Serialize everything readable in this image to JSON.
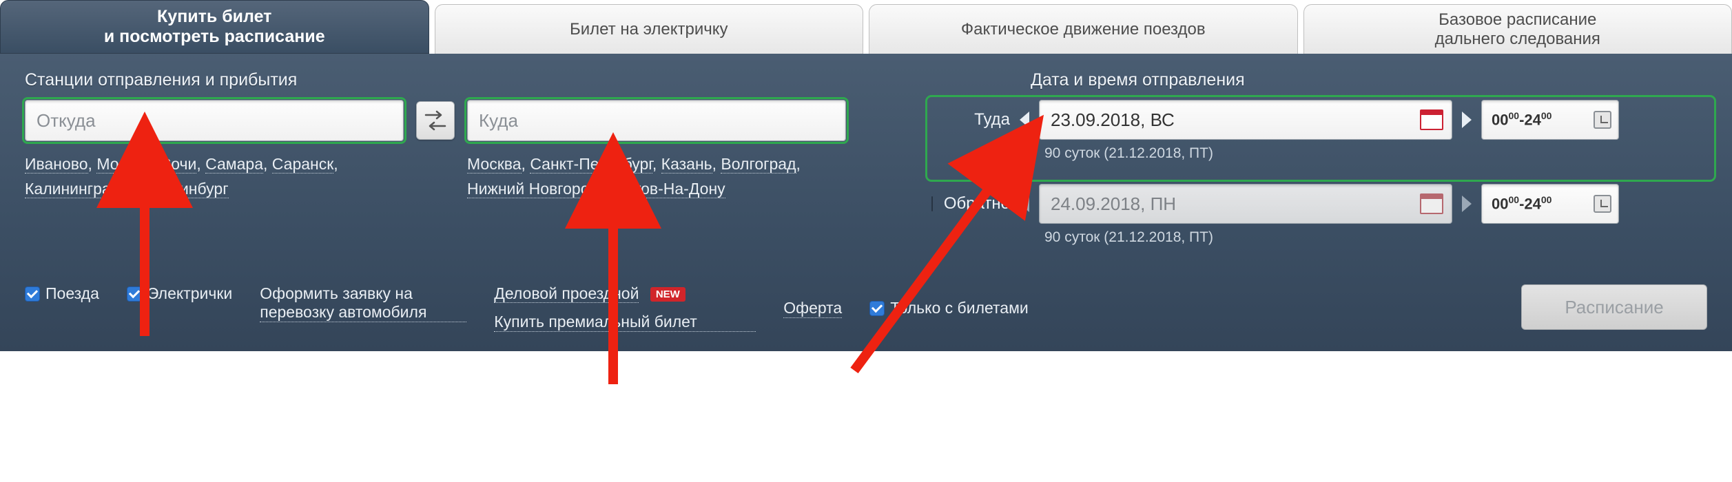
{
  "tabs": {
    "buy": "Купить билет\nи посмотреть расписание",
    "suburban": "Билет на электричку",
    "actual": "Фактическое движение поездов",
    "base": "Базовое расписание\nдальнего следования"
  },
  "labels": {
    "stations": "Станции отправления и прибытия",
    "datetime": "Дата и время отправления",
    "there": "Туда",
    "back": "Обратно"
  },
  "inputs": {
    "from_placeholder": "Откуда",
    "to_placeholder": "Куда"
  },
  "from_cities": [
    "Иваново",
    "Москва",
    "Сочи",
    "Самара",
    "Саранск",
    "Калининград",
    "Екатеринбург"
  ],
  "to_cities": [
    "Москва",
    "Санкт-Петербург",
    "Казань",
    "Волгоград",
    "Нижний Новгород",
    "Ростов-На-Дону"
  ],
  "dates": {
    "there_value": "23.09.2018, ВС",
    "there_note": "90 суток (21.12.2018, ПТ)",
    "back_value": "24.09.2018, ПН",
    "back_note": "90 суток (21.12.2018, ПТ)",
    "time_from": "00",
    "time_from_min": "00",
    "time_to": "24",
    "time_to_min": "00"
  },
  "bottom": {
    "trains": "Поезда",
    "suburban": "Электрички",
    "car_transport": "Оформить заявку на перевозку автомобиля",
    "business": "Деловой проездной",
    "new": "NEW",
    "premium": "Купить премиальный билет",
    "offer": "Оферта",
    "only_tickets": "Только с билетами",
    "schedule": "Расписание"
  }
}
